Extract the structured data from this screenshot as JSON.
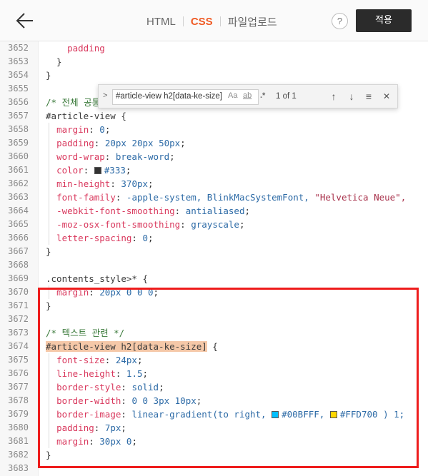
{
  "header": {
    "back_label": "←",
    "tabs": [
      {
        "label": "HTML",
        "active": false
      },
      {
        "label": "CSS",
        "active": true
      },
      {
        "label": "파일업로드",
        "active": false
      }
    ],
    "help_label": "?",
    "apply_label": "적용"
  },
  "find": {
    "toggle": ">",
    "query": "#article-view h2[data-ke-size]",
    "match_case": "Aa",
    "whole_word": "ab",
    "regex": ".*",
    "count": "1 of 1",
    "prev": "↑",
    "next": "↓",
    "in_selection": "≡",
    "close": "✕"
  },
  "colors": {
    "accent": "#ef5a24",
    "highlight_box": "#ee1c1c",
    "swatch_333": "#333333",
    "swatch_00bfff": "#00BFFF",
    "swatch_ffd700": "#FFD700"
  },
  "code_lines": [
    {
      "n": "3652",
      "t": "    padding"
    },
    {
      "n": "3653",
      "t": "  }"
    },
    {
      "n": "3654",
      "t": "}"
    },
    {
      "n": "3655",
      "t": ""
    },
    {
      "n": "3656",
      "t": "/* 전체 공통 */"
    },
    {
      "n": "3657",
      "t": "#article-view {"
    },
    {
      "n": "3658",
      "p": "margin",
      "v": "0"
    },
    {
      "n": "3659",
      "p": "padding",
      "v": "20px 20px 50px"
    },
    {
      "n": "3660",
      "p": "word-wrap",
      "v": "break-word"
    },
    {
      "n": "3661",
      "p": "color",
      "v": "#333"
    },
    {
      "n": "3662",
      "p": "min-height",
      "v": "370px"
    },
    {
      "n": "3663",
      "p": "font-family",
      "v": "-apple-system, BlinkMacSystemFont, ",
      "s": "\"Helvetica Neue\","
    },
    {
      "n": "3664",
      "p": "-webkit-font-smoothing",
      "v": "antialiased"
    },
    {
      "n": "3665",
      "p": "-moz-osx-font-smoothing",
      "v": "grayscale"
    },
    {
      "n": "3666",
      "p": "letter-spacing",
      "v": "0"
    },
    {
      "n": "3667",
      "t": "}"
    },
    {
      "n": "3668",
      "t": ""
    },
    {
      "n": "3669",
      "t": ".contents_style>* {"
    },
    {
      "n": "3670",
      "p": "margin",
      "v": "20px 0 0 0"
    },
    {
      "n": "3671",
      "t": "}"
    },
    {
      "n": "3672",
      "t": ""
    },
    {
      "n": "3673",
      "t": "/* 텍스트 관련 */"
    },
    {
      "n": "3674",
      "sel": "#article-view h2[data-ke-size]",
      "rest": " {"
    },
    {
      "n": "3675",
      "p": "font-size",
      "v": "24px"
    },
    {
      "n": "3676",
      "p": "line-height",
      "v": "1.5"
    },
    {
      "n": "3677",
      "p": "border-style",
      "v": "solid"
    },
    {
      "n": "3678",
      "p": "border-width",
      "v": "0 0 3px 10px"
    },
    {
      "n": "3679",
      "p": "border-image",
      "v": "linear-gradient(to right, ",
      "c1": "#00BFFF",
      "mid": ", ",
      "c2": "#FFD700",
      "end": " ) 1;"
    },
    {
      "n": "3680",
      "p": "padding",
      "v": "7px"
    },
    {
      "n": "3681",
      "p": "margin",
      "v": "30px 0"
    },
    {
      "n": "3682",
      "t": "}"
    },
    {
      "n": "3683",
      "t": ""
    }
  ]
}
